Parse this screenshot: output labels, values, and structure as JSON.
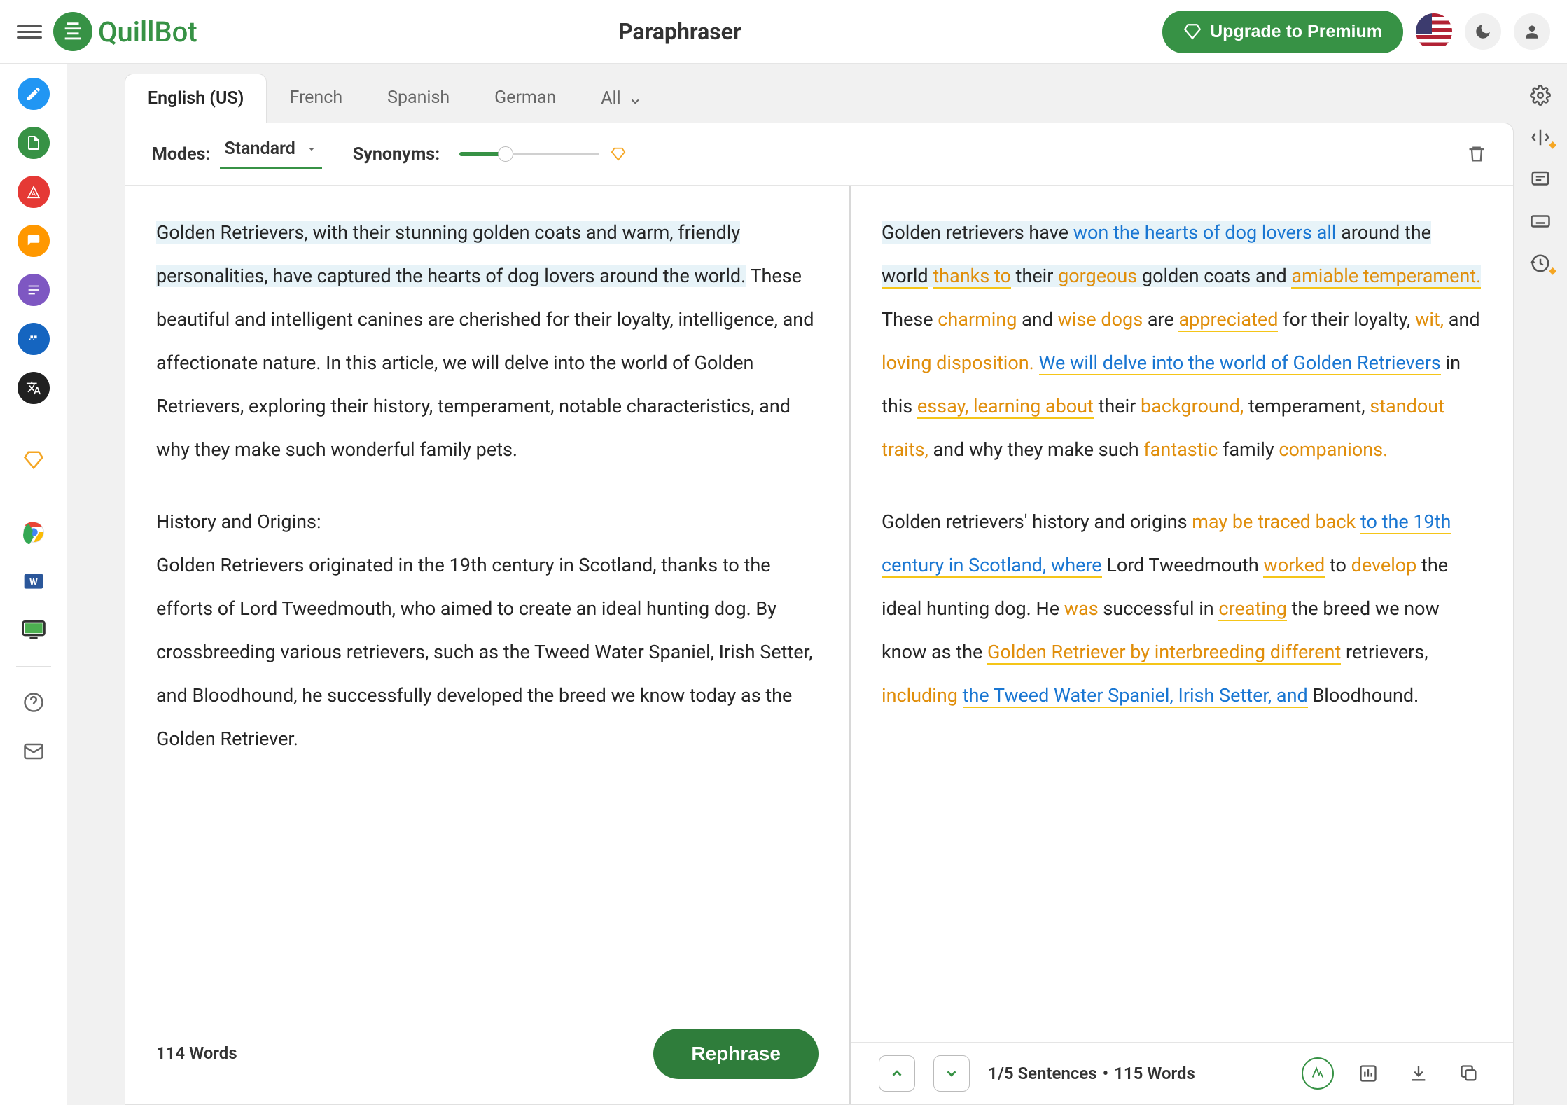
{
  "header": {
    "logo_text": "QuillBot",
    "title": "Paraphraser",
    "upgrade_label": "Upgrade to Premium"
  },
  "lang_tabs": {
    "active": "English (US)",
    "items": [
      "English (US)",
      "French",
      "Spanish",
      "German",
      "All"
    ]
  },
  "modes": {
    "label": "Modes:",
    "selected": "Standard",
    "synonyms_label": "Synonyms:"
  },
  "input": {
    "hl_sentence": "Golden Retrievers, with their stunning golden coats and warm, friendly personalities, have captured the hearts of dog lovers around the world.",
    "rest1": " These beautiful and intelligent canines are cherished for their loyalty, intelligence, and affectionate nature. In this article, we will delve into the world of Golden Retrievers, exploring their history, temperament, notable characteristics, and why they make such wonderful family pets.",
    "para2_heading": "History and Origins:",
    "para2_body": "Golden Retrievers originated in the 19th century in Scotland, thanks to the efforts of Lord Tweedmouth, who aimed to create an ideal hunting dog. By crossbreeding various retrievers, such as the Tweed Water Spaniel, Irish Setter, and Bloodhound, he successfully developed the breed we know today as the Golden Retriever.",
    "word_count": "114 Words",
    "rephrase_label": "Rephrase"
  },
  "output": {
    "s1": {
      "t1": "Golden retrievers have ",
      "t2": "won",
      "t3": " ",
      "t4": "the hearts of dog lovers",
      "t5": " ",
      "t6": "all",
      "t7": " around the ",
      "t8": "world",
      "t9": " ",
      "t10": "thanks to",
      "t11": " their ",
      "t12": "gorgeous",
      "t13": " golden coats and ",
      "t14": "amiable temperament."
    },
    "s2": {
      "t1": " These ",
      "t2": "charming",
      "t3": " and ",
      "t4": "wise dogs",
      "t5": " are ",
      "t6": "appreciated",
      "t7": " for their loyalty, ",
      "t8": "wit,",
      "t9": " and ",
      "t10": "loving disposition."
    },
    "s3": {
      "t1": " ",
      "t2": "We will delve into the world of Golden Retrievers",
      "t3": " in this ",
      "t4": "essay, learning about",
      "t5": " their ",
      "t6": "background,",
      "t7": " temperament, ",
      "t8": "standout traits,",
      "t9": " and why they make such ",
      "t10": "fantastic",
      "t11": " family ",
      "t12": "companions."
    },
    "p2": {
      "t1": "Golden retrievers' history and origins ",
      "t2": "may be traced back",
      "t3": " ",
      "t4": "to the 19th century in Scotland, where",
      "t5": " Lord Tweedmouth ",
      "t6": "worked",
      "t7": " to ",
      "t8": "develop",
      "t9": " the ideal hunting dog. He ",
      "t10": "was",
      "t11": " successful in ",
      "t12": "creating",
      "t13": " the breed we now know as the ",
      "t14": "Golden Retriever by interbreeding different",
      "t15": " retrievers, ",
      "t16": "including",
      "t17": " ",
      "t18": "the Tweed Water Spaniel, Irish Setter, and",
      "t19": " Bloodhound."
    },
    "sentences_info": "1/5 Sentences",
    "word_count": "115 Words"
  }
}
